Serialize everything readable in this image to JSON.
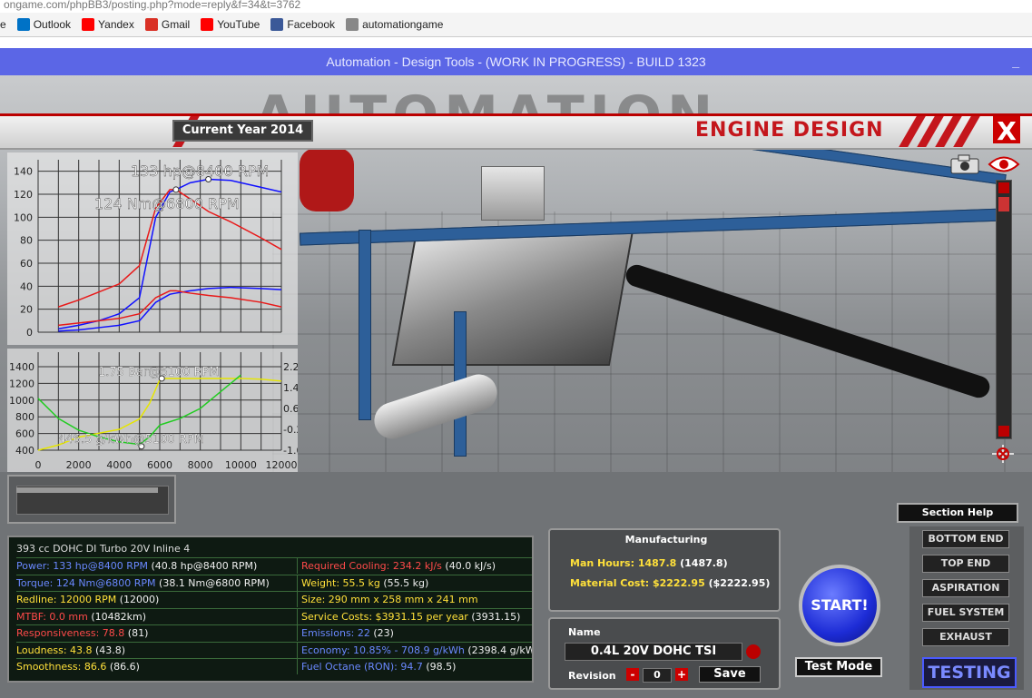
{
  "browser": {
    "url": "ongame.com/phpBB3/posting.php?mode=reply&f=34&t=3762",
    "bookmarks": [
      {
        "label": "e",
        "icon": "page-icon"
      },
      {
        "label": "Outlook",
        "icon": "outlook-icon",
        "color": "#0072c6"
      },
      {
        "label": "Yandex",
        "icon": "yandex-icon",
        "color": "#ff0000"
      },
      {
        "label": "Gmail",
        "icon": "gmail-icon",
        "color": "#d93025"
      },
      {
        "label": "YouTube",
        "icon": "youtube-icon",
        "color": "#ff0000"
      },
      {
        "label": "Facebook",
        "icon": "facebook-icon",
        "color": "#3b5998"
      },
      {
        "label": "automationgame",
        "icon": "gear-icon",
        "color": "#888888"
      }
    ]
  },
  "window": {
    "title": "Automation - Design Tools - (WORK IN PROGRESS) - BUILD 1323",
    "minimize": "_"
  },
  "header": {
    "year": "Current Year 2014",
    "section": "ENGINE DESIGN",
    "close": "X"
  },
  "chart_data": [
    {
      "type": "line",
      "title": "",
      "x": [
        1000,
        2000,
        3000,
        4000,
        5000,
        5800,
        6500,
        6800,
        7500,
        8400,
        9500,
        11000,
        12000
      ],
      "ylim": [
        0,
        150
      ],
      "yticks": [
        0,
        20,
        40,
        60,
        80,
        100,
        120,
        140
      ],
      "series": [
        {
          "color": "#1010ff",
          "values": [
            3,
            6,
            10,
            16,
            30,
            100,
            122,
            124,
            130,
            133,
            132,
            126,
            122
          ]
        },
        {
          "color": "#e81a1a",
          "values": [
            22,
            28,
            35,
            42,
            58,
            108,
            124,
            124,
            116,
            105,
            96,
            82,
            72
          ]
        },
        {
          "color": "#1010ff",
          "values": [
            1,
            2,
            4,
            6,
            10,
            26,
            33,
            34,
            36,
            38,
            39,
            38,
            37
          ]
        },
        {
          "color": "#e81a1a",
          "values": [
            6,
            8,
            10,
            12,
            16,
            30,
            36,
            36,
            34,
            32,
            30,
            26,
            22
          ]
        }
      ],
      "annotations": [
        "133 hp@8400 RPM",
        "124 Nm@6800 RPM"
      ]
    },
    {
      "type": "line",
      "title": "",
      "x": [
        0,
        1000,
        2000,
        3000,
        4000,
        5000,
        5500,
        6000,
        6100,
        7000,
        8000,
        9000,
        10000,
        11000,
        12000
      ],
      "xticks": [
        0,
        2000,
        4000,
        6000,
        8000,
        10000,
        12000
      ],
      "ylim_left": [
        400,
        1400
      ],
      "yticks_left": [
        400,
        600,
        800,
        1000,
        1200,
        1400
      ],
      "ylim_right": [
        -1.0,
        2.2
      ],
      "yticks_right": [
        "2.2",
        "1.4",
        "0.6",
        "-0.2",
        "-1.0"
      ],
      "series": [
        {
          "color": "#e6e600",
          "axis": "right",
          "values": [
            -1.0,
            -0.8,
            -0.5,
            -0.35,
            -0.2,
            0.2,
            0.8,
            1.7,
            1.75,
            1.75,
            1.75,
            1.75,
            1.75,
            1.72,
            1.65
          ]
        },
        {
          "color": "#22cc22",
          "axis": "left",
          "values": [
            1020,
            780,
            640,
            560,
            500,
            470,
            560,
            700,
            710,
            780,
            900,
            1100,
            1300,
            null,
            null
          ]
        }
      ],
      "annotations": [
        "1.75 Bar@6100 RPM",
        "446.5 g/kWh@5100 RPM"
      ]
    }
  ],
  "stats": {
    "header": "393 cc DOHC DI Turbo 20V Inline 4",
    "left": [
      {
        "label": "Power: 133 hp@8400 RPM",
        "extra": " (40.8 hp@8400 RPM)",
        "color": "#6a88ff"
      },
      {
        "label": "Torque: 124 Nm@6800 RPM",
        "extra": " (38.1 Nm@6800 RPM)",
        "color": "#6a88ff"
      },
      {
        "label": "Redline: 12000 RPM",
        "extra": " (12000)",
        "color": "#ffe03a"
      },
      {
        "label": "MTBF: 0.0 mm",
        "extra": " (10482km)",
        "color": "#ff4a4a"
      },
      {
        "label": "Responsiveness: 78.8",
        "extra": " (81)",
        "color": "#ff4a4a"
      },
      {
        "label": "Loudness: 43.8",
        "extra": " (43.8)",
        "color": "#ffe03a"
      },
      {
        "label": "Smoothness: 86.6",
        "extra": " (86.6)",
        "color": "#ffe03a"
      }
    ],
    "right": [
      {
        "label": "Required Cooling: 234.2 kJ/s",
        "extra": " (40.0 kJ/s)",
        "color": "#ff4a4a"
      },
      {
        "label": "Weight: 55.5 kg",
        "extra": " (55.5 kg)",
        "color": "#ffe03a"
      },
      {
        "label": "Size: 290 mm x 258 mm x 241 mm",
        "extra": "",
        "color": "#ffe03a"
      },
      {
        "label": "Service Costs: $3931.15 per year",
        "extra": " (3931.15)",
        "color": "#ffe03a"
      },
      {
        "label": "Emissions: 22",
        "extra": " (23)",
        "color": "#6a88ff"
      },
      {
        "label": "Economy: 10.85% - 708.9 g/kWh",
        "extra": " (2398.4 g/kWh",
        "color": "#6a88ff"
      },
      {
        "label": "Fuel Octane (RON): 94.7",
        "extra": " (98.5)",
        "color": "#6a88ff"
      }
    ]
  },
  "manufacturing": {
    "title": "Manufacturing",
    "man_hours_label": "Man Hours: 1487.8",
    "man_hours_extra": " (1487.8)",
    "material_label": "Material Cost: $2222.95",
    "material_extra": " ($2222.95)"
  },
  "design": {
    "name_label": "Name",
    "name_value": "0.4L 20V DOHC TSI",
    "revision_label": "Revision",
    "revision_value": "0",
    "minus": "-",
    "plus": "+",
    "save": "Save"
  },
  "actions": {
    "start": "START!",
    "test_mode": "Test Mode",
    "section_help": "Section Help",
    "testing": "TESTING"
  },
  "nav": [
    "BOTTOM END",
    "TOP END",
    "ASPIRATION",
    "FUEL SYSTEM",
    "EXHAUST"
  ]
}
